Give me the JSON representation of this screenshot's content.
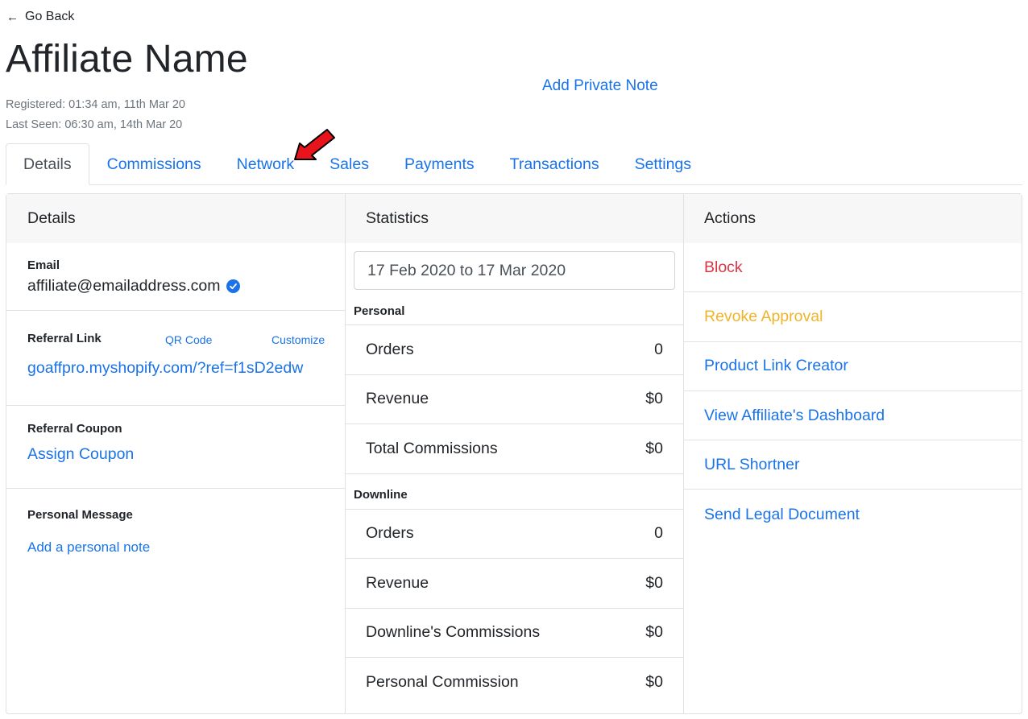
{
  "header": {
    "back_label": "Go Back",
    "title": "Affiliate Name",
    "registered": "Registered: 01:34 am, 11th Mar 20",
    "last_seen": "Last Seen: 06:30 am, 14th Mar 20",
    "private_note_label": "Add Private Note"
  },
  "tabs": [
    {
      "label": "Details",
      "active": true
    },
    {
      "label": "Commissions",
      "active": false
    },
    {
      "label": "Network",
      "active": false
    },
    {
      "label": "Sales",
      "active": false
    },
    {
      "label": "Payments",
      "active": false
    },
    {
      "label": "Transactions",
      "active": false
    },
    {
      "label": "Settings",
      "active": false
    }
  ],
  "details": {
    "title": "Details",
    "email_label": "Email",
    "email_value": "affiliate@emailaddress.com",
    "referral_label": "Referral Link",
    "qr_code_label": "QR Code",
    "customize_label": "Customize",
    "referral_link": "goaffpro.myshopify.com/?ref=f1sD2edw",
    "coupon_label": "Referral Coupon",
    "assign_coupon_label": "Assign Coupon",
    "message_label": "Personal Message",
    "add_note_label": "Add a personal note"
  },
  "statistics": {
    "title": "Statistics",
    "date_range": "17 Feb 2020 to 17 Mar 2020",
    "personal_label": "Personal",
    "personal": [
      {
        "label": "Orders",
        "value": "0"
      },
      {
        "label": "Revenue",
        "value": "$0"
      },
      {
        "label": "Total Commissions",
        "value": "$0"
      }
    ],
    "downline_label": "Downline",
    "downline": [
      {
        "label": "Orders",
        "value": "0"
      },
      {
        "label": "Revenue",
        "value": "$0"
      },
      {
        "label": "Downline's Commissions",
        "value": "$0"
      },
      {
        "label": "Personal Commission",
        "value": "$0"
      }
    ]
  },
  "actions": {
    "title": "Actions",
    "items": [
      {
        "label": "Block",
        "color": "#dc3545"
      },
      {
        "label": "Revoke Approval",
        "color": "#f0b429"
      },
      {
        "label": "Product Link Creator",
        "color": "#1a73e8"
      },
      {
        "label": "View Affiliate's Dashboard",
        "color": "#1a73e8"
      },
      {
        "label": "URL Shortner",
        "color": "#1a73e8"
      },
      {
        "label": "Send Legal Document",
        "color": "#1a73e8"
      }
    ]
  },
  "colors": {
    "link": "#1a73e8",
    "danger": "#dc3545",
    "warning": "#f0b429",
    "annotation_arrow": "#e8141b"
  },
  "icons": {
    "back": "arrow-left-icon",
    "verified": "check-circle-icon",
    "annotation": "red-arrow-icon"
  }
}
